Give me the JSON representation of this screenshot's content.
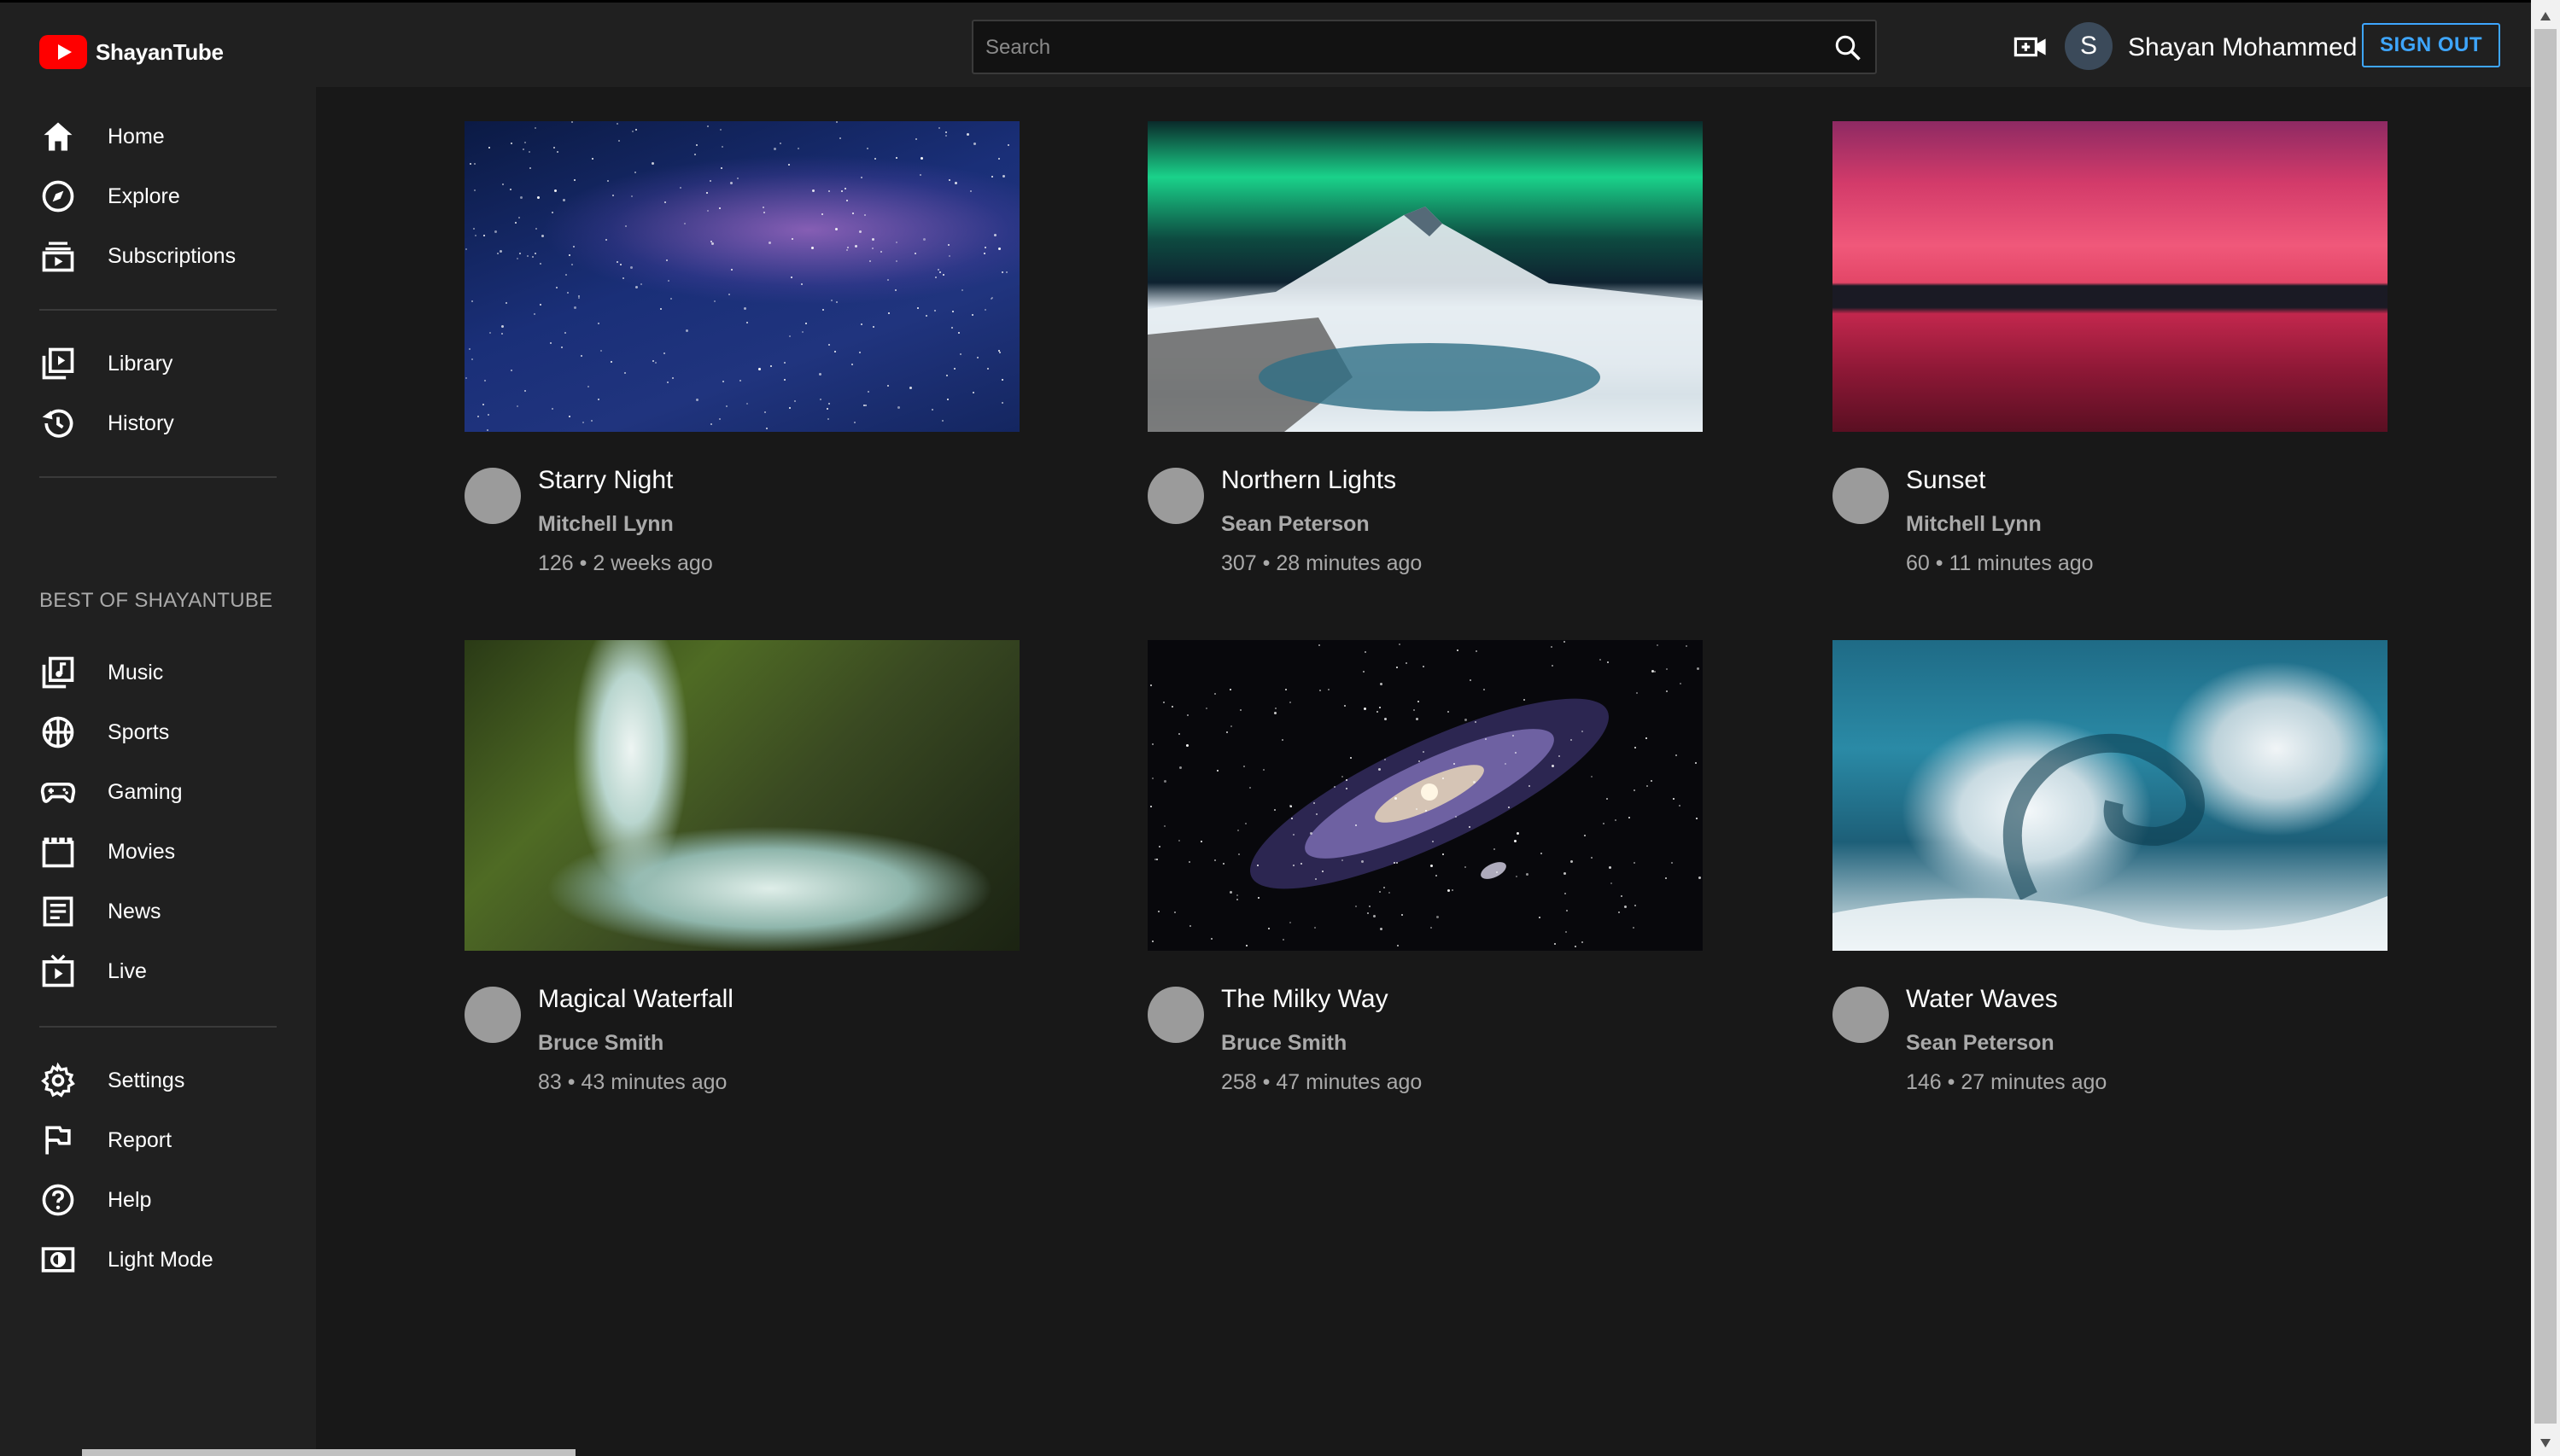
{
  "app": {
    "title": "ShayanTube"
  },
  "header": {
    "search_placeholder": "Search",
    "create_icon": "video-add-icon",
    "user_initial": "S",
    "user_name": "Shayan Mohammed",
    "signout_label": "SIGN OUT"
  },
  "sidebar": {
    "primary": [
      {
        "label": "Home",
        "icon": "home-icon"
      },
      {
        "label": "Explore",
        "icon": "compass-icon"
      },
      {
        "label": "Subscriptions",
        "icon": "subscriptions-icon"
      }
    ],
    "library": [
      {
        "label": "Library",
        "icon": "library-icon"
      },
      {
        "label": "History",
        "icon": "history-icon"
      }
    ],
    "section_title": "BEST OF SHAYANTUBE",
    "best": [
      {
        "label": "Music",
        "icon": "music-icon"
      },
      {
        "label": "Sports",
        "icon": "sports-icon"
      },
      {
        "label": "Gaming",
        "icon": "gamepad-icon"
      },
      {
        "label": "Movies",
        "icon": "film-icon"
      },
      {
        "label": "News",
        "icon": "news-icon"
      },
      {
        "label": "Live",
        "icon": "live-icon"
      }
    ],
    "settings": [
      {
        "label": "Settings",
        "icon": "gear-icon"
      },
      {
        "label": "Report",
        "icon": "flag-icon"
      },
      {
        "label": "Help",
        "icon": "help-icon"
      },
      {
        "label": "Light Mode",
        "icon": "brightness-icon"
      }
    ]
  },
  "videos": [
    {
      "title": "Starry Night",
      "channel": "Mitchell Lynn",
      "meta": "126 • 2 weeks ago",
      "thumbnail": "starry-night-sky"
    },
    {
      "title": "Northern Lights",
      "channel": "Sean Peterson",
      "meta": "307 • 28 minutes ago",
      "thumbnail": "aurora-over-mountain"
    },
    {
      "title": "Sunset",
      "channel": "Mitchell Lynn",
      "meta": "60 • 11 minutes ago",
      "thumbnail": "red-sunset-over-water"
    },
    {
      "title": "Magical Waterfall",
      "channel": "Bruce Smith",
      "meta": "83 • 43 minutes ago",
      "thumbnail": "forest-waterfall"
    },
    {
      "title": "The Milky Way",
      "channel": "Bruce Smith",
      "meta": "258 • 47 minutes ago",
      "thumbnail": "andromeda-galaxy"
    },
    {
      "title": "Water Waves",
      "channel": "Sean Peterson",
      "meta": "146 • 27 minutes ago",
      "thumbnail": "ocean-wave"
    }
  ],
  "colors": {
    "accent": "#3ea6ff",
    "brand": "#ff0000",
    "background": "#181818",
    "panel": "#202020"
  }
}
